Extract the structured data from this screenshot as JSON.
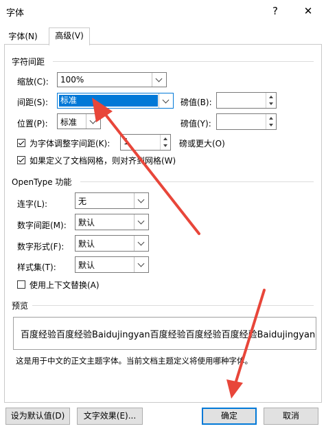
{
  "window": {
    "title": "字体",
    "help": "?",
    "close": "✕"
  },
  "tabs": [
    {
      "label": "字体(N)"
    },
    {
      "label": "高级(V)"
    }
  ],
  "spacing_section": {
    "title": "字符间距",
    "scale_label": "缩放(C):",
    "scale_value": "100%",
    "spacing_label": "间距(S):",
    "spacing_value": "标准",
    "spacing_pts_label": "磅值(B):",
    "spacing_pts_value": "",
    "position_label": "位置(P):",
    "position_value": "标准",
    "position_pts_label": "磅值(Y):",
    "position_pts_value": "",
    "kerning_label": "为字体调整字间距(K):",
    "kerning_checked": true,
    "kerning_value": "1",
    "kerning_suffix": "磅或更大(O)",
    "grid_label": "如果定义了文档网格，则对齐到网格(W)",
    "grid_checked": true
  },
  "opentype_section": {
    "title": "OpenType 功能",
    "ligatures_label": "连字(L):",
    "ligatures_value": "无",
    "number_spacing_label": "数字间距(M):",
    "number_spacing_value": "默认",
    "number_forms_label": "数字形式(F):",
    "number_forms_value": "默认",
    "stylistic_sets_label": "样式集(T):",
    "stylistic_sets_value": "默认",
    "contextual_label": "使用上下文替换(A)",
    "contextual_checked": false
  },
  "preview": {
    "title": "预览",
    "sample": "百度经验百度经验Baidujingyan百度经验百度经验百度经验Baidujingyan",
    "note": "这是用于中文的正文主题字体。当前文档主题定义将使用哪种字体。"
  },
  "footer": {
    "set_default": "设为默认值(D)",
    "text_effects": "文字效果(E)...",
    "ok": "确定",
    "cancel": "取消"
  },
  "colors": {
    "selection": "#0078d7",
    "annotation_arrow": "#e8463a"
  }
}
